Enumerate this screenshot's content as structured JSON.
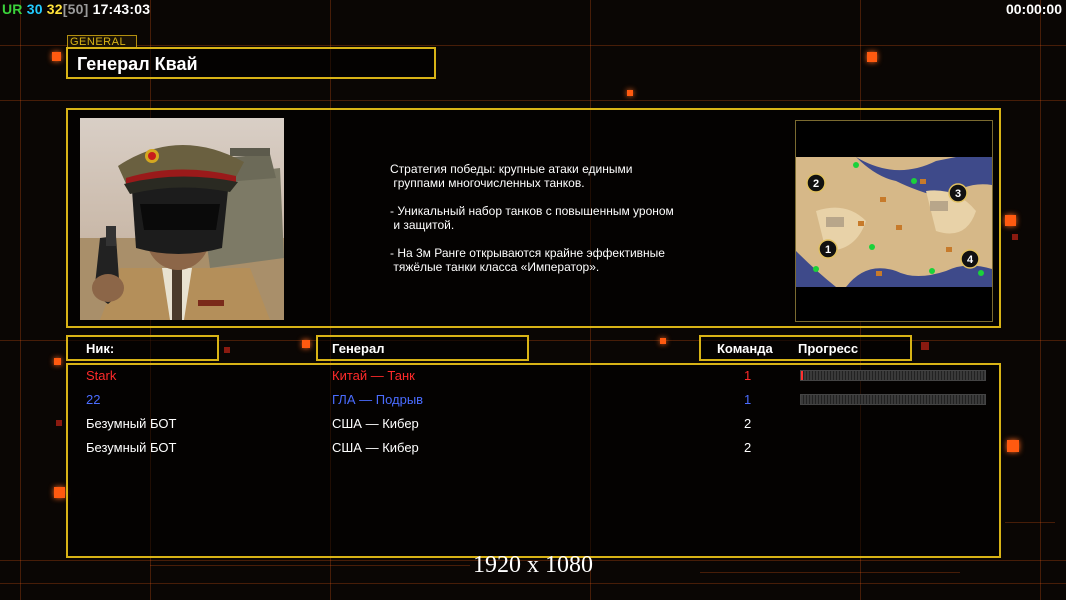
{
  "hud": {
    "ur_label": "UR",
    "val1": "30",
    "val2": "32",
    "val3": "[50]",
    "clock": "17:43:03",
    "timer": "00:00:00"
  },
  "general_tag": "GENERAL",
  "title": "Генерал Квай",
  "description": "Стратегия победы: крупные атаки едиными\n группами многочисленных танков.\n\n- Уникальный набор танков с повышенным уроном\n и защитой.\n\n- На 3м Ранге открываются крайне эффективные\n тяжёлые танки класса «Император».",
  "minimap": {
    "spawns": [
      "1",
      "2",
      "3",
      "4"
    ]
  },
  "headers": {
    "nick": "Ник:",
    "general": "Генерал",
    "team": "Команда",
    "progress": "Прогресс"
  },
  "players": [
    {
      "name": "Stark",
      "general": "Китай — Танк",
      "team": "1",
      "color": "#ff2a2a",
      "has_progress": true,
      "progress": 0.01
    },
    {
      "name": "22",
      "general": "ГЛА — Подрыв",
      "team": "1",
      "color": "#4a6cff",
      "has_progress": true,
      "progress": 0
    },
    {
      "name": "Безумный БОТ",
      "general": "США — Кибер",
      "team": "2",
      "color": "#ffffff",
      "has_progress": false,
      "progress": 0
    },
    {
      "name": "Безумный БОТ",
      "general": "США — Кибер",
      "team": "2",
      "color": "#ffffff",
      "has_progress": false,
      "progress": 0
    }
  ],
  "resolution": "1920 x 1080",
  "colors": {
    "frame": "#d8b316",
    "accent": "#ff5a10",
    "background": "#0a0604"
  }
}
